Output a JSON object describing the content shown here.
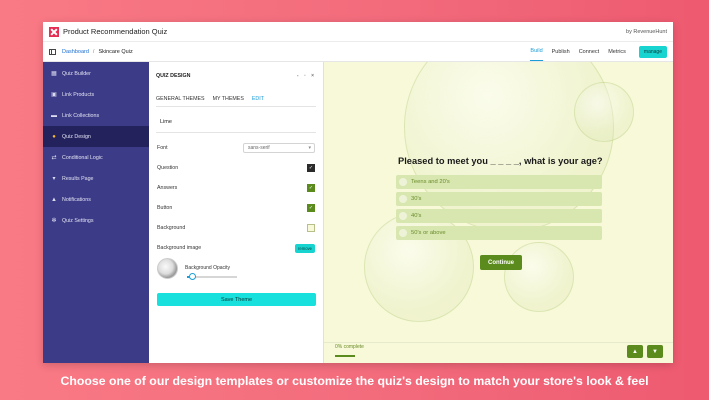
{
  "app": {
    "title": "Product Recommendation Quiz",
    "byline": "by RevenueHunt"
  },
  "breadcrumb": {
    "root": "Dashboard",
    "separator": "/",
    "current": "Skincare Quiz"
  },
  "nav": {
    "tabs": [
      "Build",
      "Publish",
      "Connect",
      "Metrics"
    ],
    "active": "Build",
    "manage_label": "manage"
  },
  "sidebar": {
    "items": [
      {
        "label": "Quiz Builder",
        "icon": "grid-icon"
      },
      {
        "label": "Link Products",
        "icon": "box-icon"
      },
      {
        "label": "Link Collections",
        "icon": "folder-icon"
      },
      {
        "label": "Quiz Design",
        "icon": "drop-icon",
        "active": true
      },
      {
        "label": "Conditional Logic",
        "icon": "branch-icon"
      },
      {
        "label": "Results Page",
        "icon": "cart-icon"
      },
      {
        "label": "Notifications",
        "icon": "bell-icon"
      },
      {
        "label": "Quiz Settings",
        "icon": "gear-icon"
      }
    ]
  },
  "panel": {
    "title": "QUIZ DESIGN",
    "controls": "- ▫ ×",
    "tabs": [
      "GENERAL THEMES",
      "MY THEMES",
      "EDIT"
    ],
    "active_tab": "EDIT",
    "theme_name": "Lime",
    "font_label": "Font",
    "font_value": "sans-serif",
    "question_label": "Question",
    "answers_label": "Answers",
    "button_label": "Button",
    "background_label": "Background",
    "bg_image_label": "Background image",
    "remove_label": "remove",
    "opacity_label": "Background Opacity",
    "opacity_value": 0.1,
    "save_label": "Save Theme",
    "colors": {
      "question": "#222222",
      "answers": "#5b8b1c",
      "button": "#5b8b1c",
      "background": "#f7f9d8"
    }
  },
  "preview": {
    "question": "Pleased to meet you _ _ _ _, what is your age?",
    "answers": [
      "Teens and 20's",
      "30's",
      "40's",
      "50's or above"
    ],
    "continue_label": "Continue",
    "progress_label": "0% complete",
    "up_arrow": "▲",
    "down_arrow": "▼"
  },
  "caption": "Choose one of our design templates or customize the quiz's design to match your store's look & feel"
}
